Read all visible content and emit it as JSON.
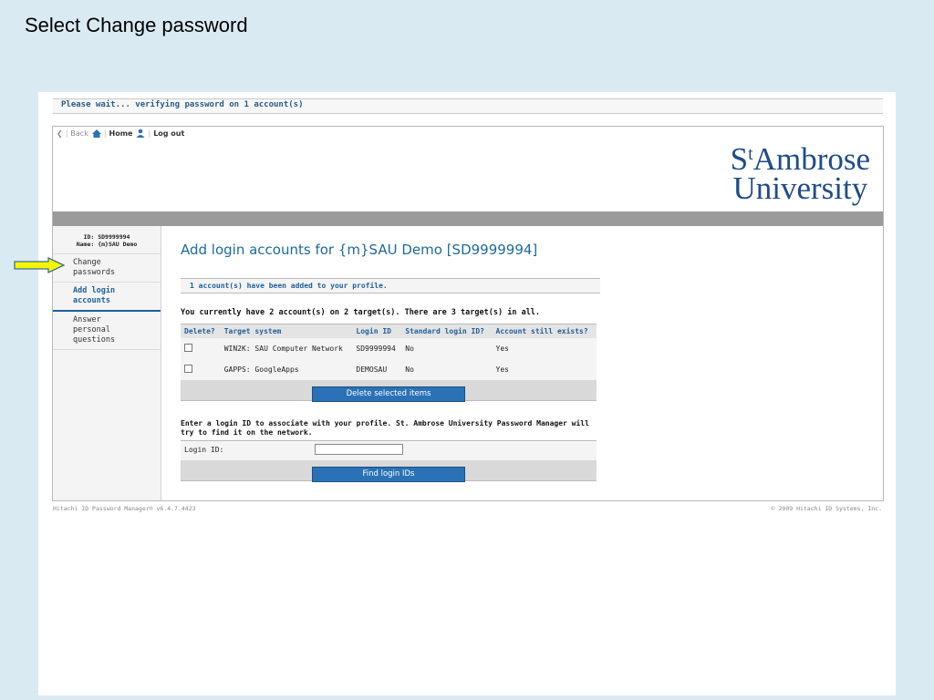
{
  "slide": {
    "title": "Select Change password"
  },
  "status": {
    "wait_message": "Please wait... verifying password on 1 account(s)"
  },
  "nav": {
    "back": "Back",
    "home": "Home",
    "logout": "Log out"
  },
  "logo": {
    "line1_prefix": "S",
    "line1_sup": "t",
    "line1_rest": "Ambrose",
    "line2": "University"
  },
  "sidebar": {
    "id_line": "ID: SD9999994",
    "name_line": "Name: {m}SAU Demo",
    "items": [
      {
        "label": "Change passwords"
      },
      {
        "label": "Add login accounts"
      },
      {
        "label": "Answer personal questions"
      }
    ]
  },
  "main": {
    "heading": "Add login accounts for {m}SAU Demo [SD9999994]",
    "notice": "1 account(s) have been added to your profile.",
    "count_text": "You currently have 2 account(s) on 2 target(s). There are 3 target(s) in all.",
    "table": {
      "headers": [
        "Delete?",
        "Target system",
        "Login ID",
        "Standard login ID?",
        "Account still exists?"
      ],
      "rows": [
        {
          "target": "WIN2K: SAU Computer Network",
          "login": "SD9999994",
          "standard": "No",
          "exists": "Yes"
        },
        {
          "target": "GAPPS: GoogleApps",
          "login": "DEMOSAU",
          "standard": "No",
          "exists": "Yes"
        }
      ]
    },
    "delete_button": "Delete selected items",
    "enter_text": "Enter a login ID to associate with your profile. St. Ambrose University Password Manager will try to find it on the network.",
    "login_label": "Login ID:",
    "login_value": "",
    "find_button": "Find login IDs"
  },
  "footer": {
    "left": "Hitachi ID Password Manager® v6.4.7.4423",
    "right": "© 2009 Hitachi ID Systems, Inc."
  },
  "colors": {
    "accent": "#1d6a9c",
    "button": "#2a72b5",
    "arrow": "#f5f500"
  }
}
